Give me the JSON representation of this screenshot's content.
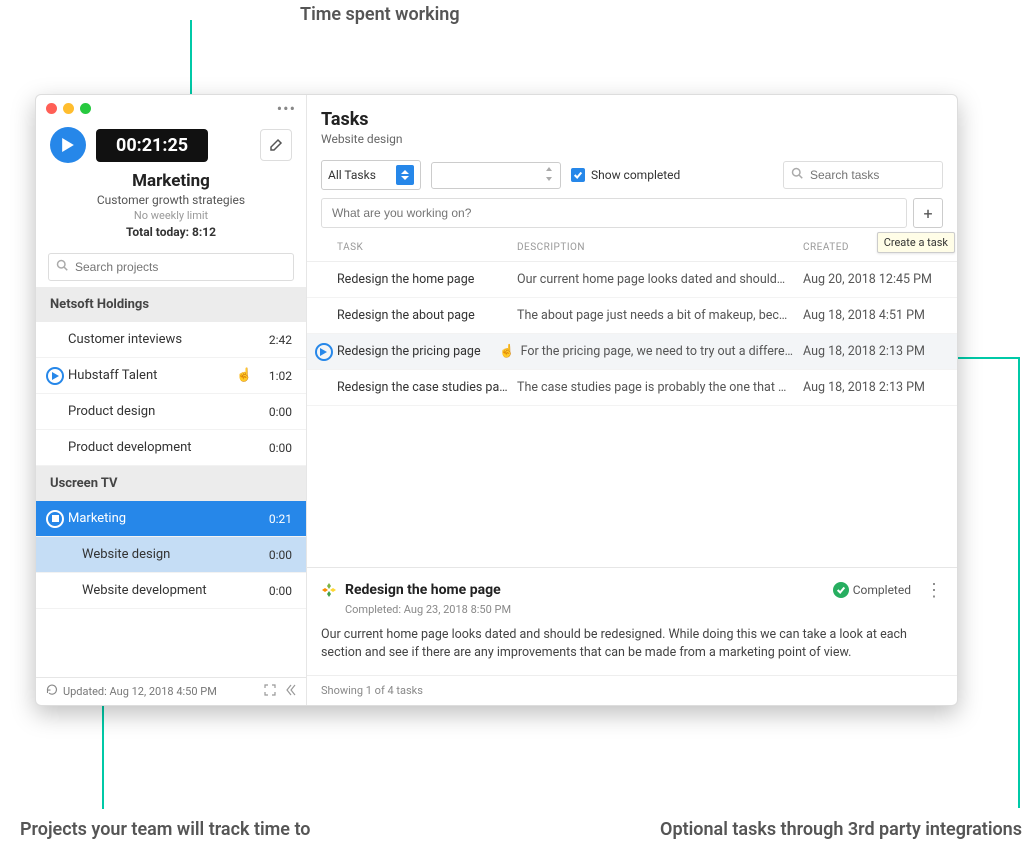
{
  "annotations": {
    "top": "Time spent working",
    "bottom_left": "Projects your team will track time to",
    "bottom_right": "Optional tasks through 3rd party integrations"
  },
  "timer": {
    "value": "00:21:25"
  },
  "current_project": {
    "title": "Marketing",
    "subtitle": "Customer growth strategies",
    "limit": "No weekly limit",
    "total_today": "Total today: 8:12"
  },
  "search_projects_placeholder": "Search projects",
  "groups": [
    {
      "name": "Netsoft Holdings",
      "projects": [
        {
          "name": "Customer inteviews",
          "time": "2:42",
          "play": false,
          "active": false
        },
        {
          "name": "Hubstaff Talent",
          "time": "1:02",
          "play": true,
          "active": false,
          "cursor": true
        },
        {
          "name": "Product design",
          "time": "0:00",
          "play": false,
          "active": false
        },
        {
          "name": "Product development",
          "time": "0:00",
          "play": false,
          "active": false
        }
      ]
    },
    {
      "name": "Uscreen TV",
      "projects": [
        {
          "name": "Marketing",
          "time": "0:21",
          "play": false,
          "active": true,
          "stop": true
        },
        {
          "name": "Website design",
          "time": "0:00",
          "play": false,
          "child": true,
          "childsel": true
        },
        {
          "name": "Website development",
          "time": "0:00",
          "play": false,
          "child": true
        }
      ]
    }
  ],
  "footer": {
    "updated": "Updated: Aug 12, 2018 4:50 PM"
  },
  "tasks_panel": {
    "title": "Tasks",
    "subtitle": "Website design",
    "filter_all": "All Tasks",
    "show_completed": "Show completed",
    "search_placeholder": "Search tasks",
    "add_placeholder": "What are you working on?",
    "tooltip": "Create a task",
    "columns": {
      "task": "TASK",
      "desc": "DESCRIPTION",
      "created": "CREATED"
    },
    "rows": [
      {
        "task": "Redesign the home page",
        "desc": "Our current home page looks dated and should…",
        "created": "Aug 20, 2018 12:45 PM",
        "selected": false,
        "play": false
      },
      {
        "task": "Redesign the about page",
        "desc": "The about page just needs a bit of makeup, bec…",
        "created": "Aug 18, 2018 4:51 PM",
        "selected": false,
        "play": false
      },
      {
        "task": "Redesign the pricing page",
        "desc": "For the pricing page, we need to try out a differe…",
        "created": "Aug 18, 2018 2:13 PM",
        "selected": true,
        "play": true,
        "cursor": true
      },
      {
        "task": "Redesign the case studies pa…",
        "desc": "The case studies page is probably the one that …",
        "created": "Aug 18, 2018 2:13 PM",
        "selected": false,
        "play": false
      }
    ],
    "detail": {
      "title": "Redesign the home page",
      "completed_label": "Completed",
      "completed_at": "Completed: Aug 23, 2018 8:50 PM",
      "body": "Our current home page looks dated and should be redesigned. While doing this we can take a look at each section and see if there are any improvements that can be made from a marketing point of view."
    },
    "showing": "Showing 1 of 4 tasks"
  }
}
